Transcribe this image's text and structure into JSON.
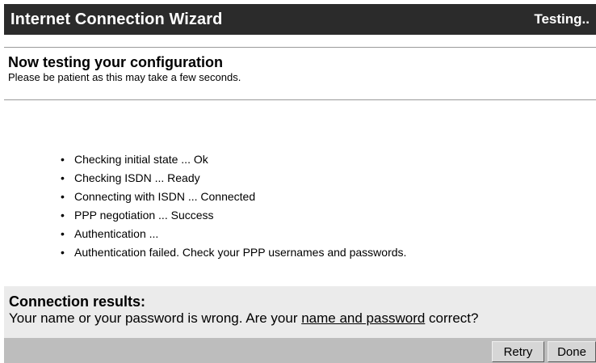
{
  "window": {
    "title": "Internet Connection Wizard",
    "status": "Testing.."
  },
  "header": {
    "heading": "Now testing your configuration",
    "subtext": "Please be patient as this may take a few seconds."
  },
  "steps": [
    "Checking initial state ... Ok",
    "Checking ISDN ... Ready",
    "Connecting with ISDN ... Connected",
    "PPP negotiation ... Success",
    "Authentication ...",
    "Authentication failed. Check your PPP usernames and passwords."
  ],
  "results": {
    "heading": "Connection results:",
    "message_before": "Your name or your password is wrong. Are your ",
    "link_text": "name and password",
    "message_after": " correct?"
  },
  "buttons": {
    "retry": "Retry",
    "done": "Done"
  },
  "icons": {
    "bullet": "•"
  },
  "colors": {
    "titlebar_bg": "#2b2b2b",
    "titlebar_fg": "#ffffff",
    "results_bg": "#ebebeb",
    "footer_bg": "#bdbdbd"
  }
}
